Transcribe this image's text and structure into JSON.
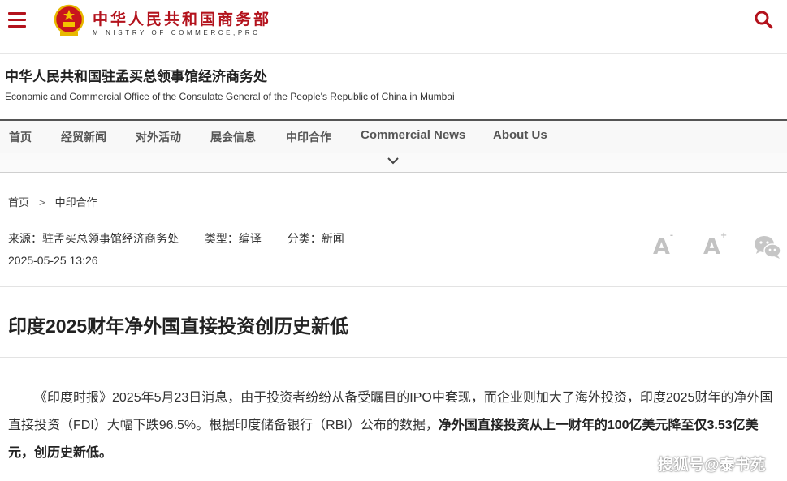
{
  "header": {
    "ministry_cn": "中华人民共和国商务部",
    "ministry_en": "MINISTRY OF COMMERCE,PRC",
    "emblem_icon": "national-emblem-icon",
    "menu_icon": "hamburger-menu-icon",
    "search_icon": "search-icon",
    "brand_color": "#b3121c"
  },
  "office": {
    "name_cn": "中华人民共和国驻孟买总领事馆经济商务处",
    "name_en": "Economic and Commercial Office of the Consulate General of the People's Republic of China in Mumbai"
  },
  "nav": {
    "items": [
      {
        "label": "首页"
      },
      {
        "label": "经贸新闻"
      },
      {
        "label": "对外活动"
      },
      {
        "label": "展会信息"
      },
      {
        "label": "中印合作"
      },
      {
        "label": "Commercial News"
      },
      {
        "label": "About Us"
      }
    ],
    "expand_icon": "chevron-down-icon"
  },
  "breadcrumb": {
    "home": "首页",
    "separator": ">",
    "current": "中印合作"
  },
  "meta": {
    "source": "来源：驻孟买总领事馆经济商务处",
    "type": "类型：编译",
    "category": "分类：新闻",
    "datetime": "2025-05-25 13:26",
    "font_decrease": "A",
    "font_decrease_mark": "-",
    "font_increase": "A",
    "font_increase_mark": "+",
    "share_icon": "wechat-icon"
  },
  "article": {
    "title": "印度2025财年净外国直接投资创历史新低",
    "paragraph_normal": "《印度时报》2025年5月23日消息，由于投资者纷纷从备受瞩目的IPO中套现，而企业则加大了海外投资，印度2025财年的净外国直接投资（FDI）大幅下跌96.5%。根据印度储备银行（RBI）公布的数据，",
    "paragraph_bold": "净外国直接投资从上一财年的100亿美元降至仅3.53亿美元，创历史新低。"
  },
  "watermark": "搜狐号@泰书苑"
}
